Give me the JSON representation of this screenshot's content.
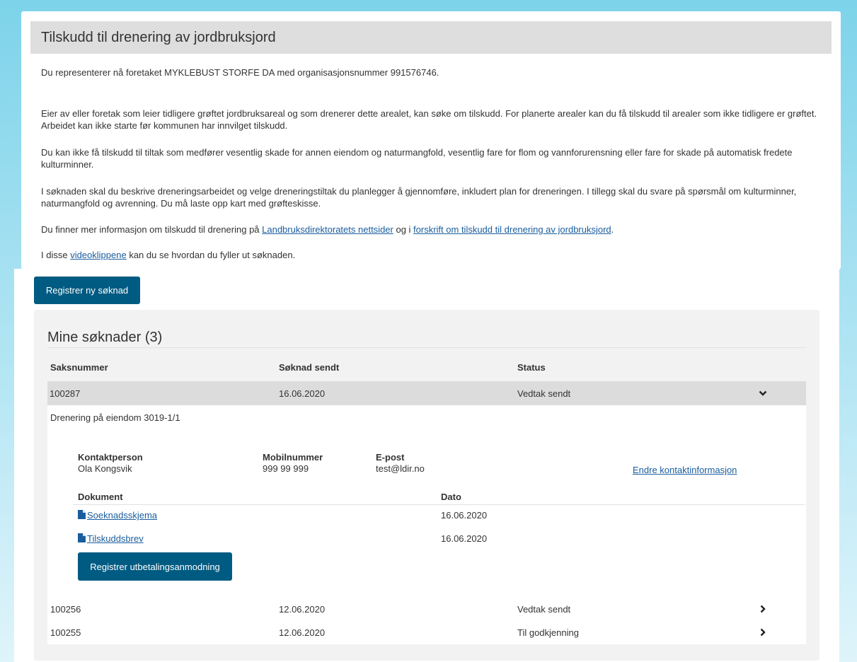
{
  "header": {
    "title": "Tilskudd til drenering av jordbruksjord"
  },
  "intro": {
    "represent": "Du representerer nå foretaket MYKLEBUST STORFE DA med organisasjonsnummer 991576746.",
    "p1": "Eier av eller foretak som leier tidligere grøftet jordbruksareal og som drenerer dette arealet, kan søke om tilskudd. For planerte arealer kan du få tilskudd til arealer som ikke tidligere er grøftet. Arbeidet kan ikke starte før kommunen har innvilget tilskudd.",
    "p2": "Du kan ikke få tilskudd til tiltak som medfører vesentlig skade for annen eiendom og naturmangfold, vesentlig fare for flom og vannforurensning eller fare for skade på automatisk fredete kulturminner.",
    "p3": "I søknaden skal du beskrive dreneringsarbeidet og velge dreneringstiltak du planlegger å gjennomføre, inkludert plan for dreneringen. I tillegg skal du svare på spørsmål om kulturminner, naturmangfold og avrenning. Du må laste opp kart med grøfteskisse.",
    "p4_before": "Du finner mer informasjon om tilskudd til drenering på ",
    "p4_link1": "Landbruksdirektoratets nettsider",
    "p4_mid": " og i ",
    "p4_link2": "forskrift om tilskudd til drenering av jordbruksjord",
    "p4_after": ".",
    "p5_before": "I disse ",
    "p5_link": "videoklippene",
    "p5_after": " kan du se hvordan du fyller ut søknaden."
  },
  "register_button": "Registrer ny søknad",
  "applications": {
    "title": "Mine søknader (3)",
    "columns": {
      "case": "Saksnummer",
      "sent": "Søknad sendt",
      "status": "Status"
    },
    "rows": [
      {
        "case": "100287",
        "sent": "16.06.2020",
        "status": "Vedtak sendt",
        "expanded": true
      },
      {
        "case": "100256",
        "sent": "12.06.2020",
        "status": "Vedtak sendt",
        "expanded": false
      },
      {
        "case": "100255",
        "sent": "12.06.2020",
        "status": "Til godkjenning",
        "expanded": false
      }
    ],
    "detail": {
      "description": "Drenering på eiendom 3019-1/1",
      "contact_label": "Kontaktperson",
      "contact_value": "Ola Kongsvik",
      "mobile_label": "Mobilnummer",
      "mobile_value": "999 99 999",
      "email_label": "E-post",
      "email_value": "test@ldir.no",
      "edit_contact_link": "Endre kontaktinformasjon",
      "doc_col": "Dokument",
      "date_col": "Dato",
      "documents": [
        {
          "name": "Soeknadsskjema",
          "date": "16.06.2020"
        },
        {
          "name": "Tilskuddsbrev",
          "date": "16.06.2020"
        }
      ],
      "payment_button": "Registrer utbetalingsanmodning"
    }
  },
  "icons": {
    "expanded": "chevron-down-icon",
    "collapsed": "chevron-right-icon",
    "document": "document-icon"
  },
  "colors": {
    "primary": "#005b82",
    "link": "#1a5d9e",
    "title_bar": "#dedede",
    "panel": "#f2f2f2",
    "selected_row": "#dcdcdc"
  }
}
